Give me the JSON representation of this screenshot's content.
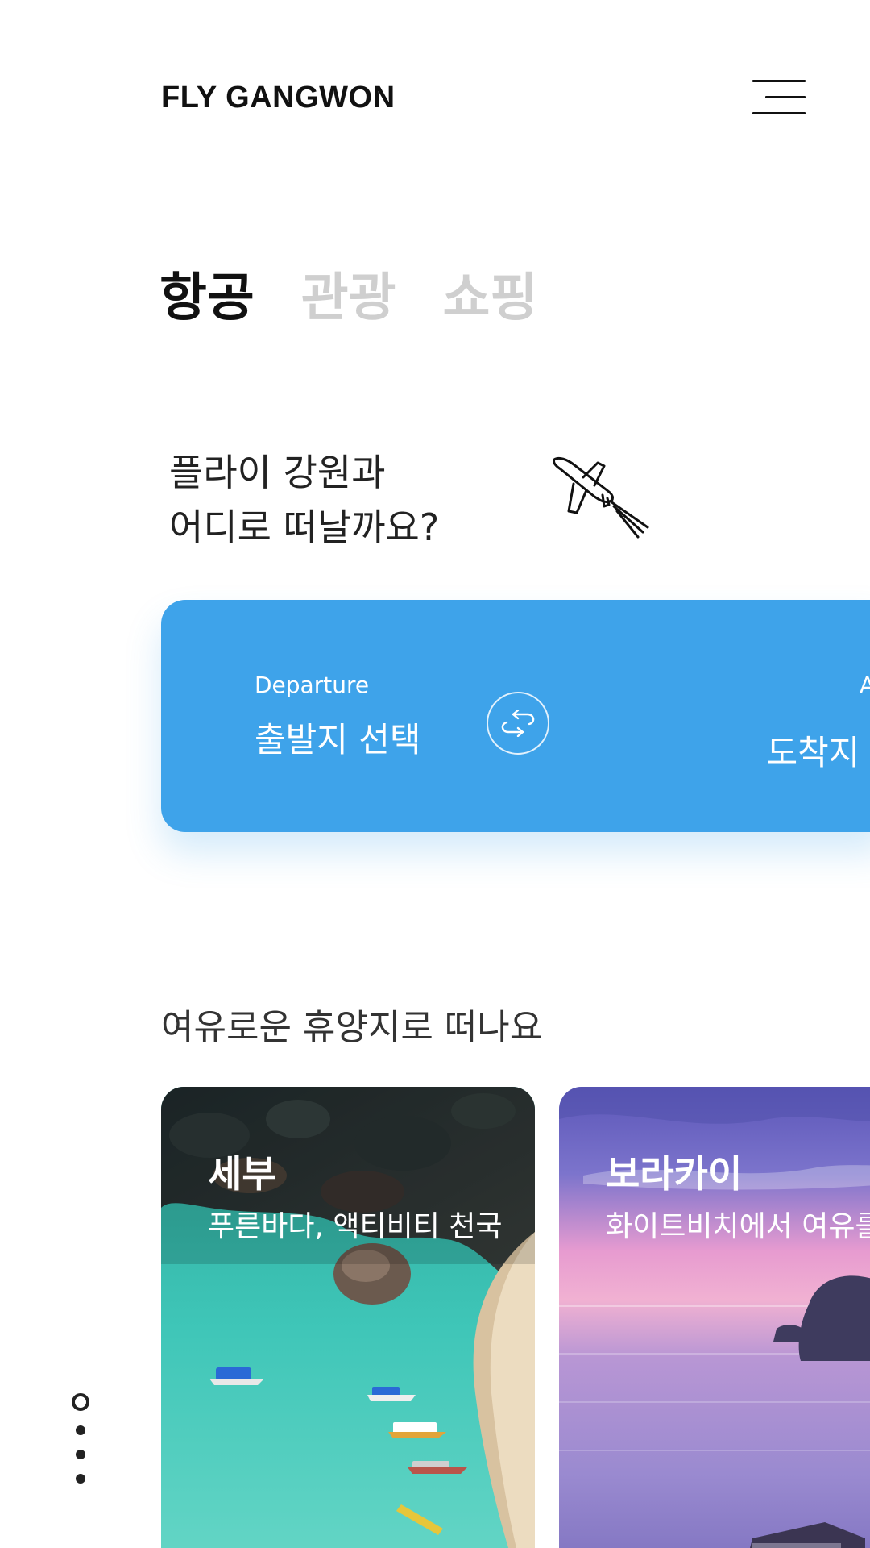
{
  "header": {
    "logo": "FLY GANGWON",
    "menu_icon": "hamburger-menu-icon"
  },
  "tabs": [
    {
      "label": "항공",
      "active": true
    },
    {
      "label": "관광",
      "active": false
    },
    {
      "label": "쇼핑",
      "active": false
    }
  ],
  "question": {
    "line1": "플라이 강원과",
    "line2": "어디로 떠날까요?",
    "icon": "airplane-icon"
  },
  "flight": {
    "departure_label": "Departure",
    "departure_value": "출발지 선택",
    "arrival_label": "Arrival",
    "arrival_value": "도착지 선택",
    "swap_icon": "swap-route-icon",
    "color": "#3ea3ea"
  },
  "destinations": {
    "title": "여유로운 휴양지로 떠나요",
    "cards": [
      {
        "name": "세부",
        "desc": "푸른바다, 액티비티 천국"
      },
      {
        "name": "보라카이",
        "desc": "화이트비치에서 여유를"
      }
    ]
  },
  "pagination": {
    "count": 4,
    "current": 1
  }
}
